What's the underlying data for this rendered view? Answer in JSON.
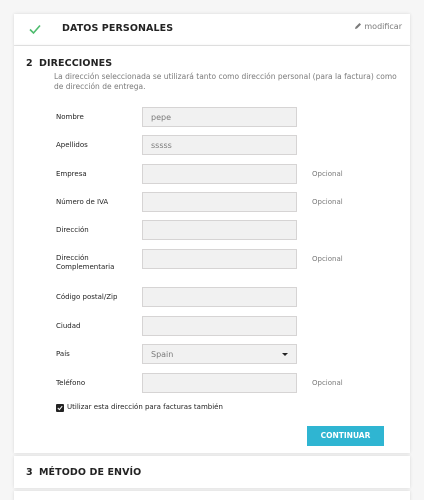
{
  "personal": {
    "title": "DATOS PERSONALES",
    "modify": "modificar"
  },
  "addresses": {
    "step": "2",
    "title": "DIRECCIONES",
    "intro": "La dirección seleccionada se utilizará tanto como dirección personal (para la factura) como de dirección de entrega.",
    "fields": {
      "nombre": {
        "label": "Nombre",
        "value": "pepe"
      },
      "apellidos": {
        "label": "Apellidos",
        "value": "sssss"
      },
      "empresa": {
        "label": "Empresa",
        "value": "",
        "optional": "Opcional"
      },
      "iva": {
        "label": "Número de IVA",
        "value": "",
        "optional": "Opcional"
      },
      "direccion": {
        "label": "Dirección",
        "value": ""
      },
      "direccion2": {
        "label": "Dirección Complementaria",
        "value": "",
        "optional": "Opcional"
      },
      "cp": {
        "label": "Código postal/Zip",
        "value": ""
      },
      "ciudad": {
        "label": "Ciudad",
        "value": ""
      },
      "pais": {
        "label": "País",
        "value": "Spain"
      },
      "telefono": {
        "label": "Teléfono",
        "value": "",
        "optional": "Opcional"
      }
    },
    "use_for_invoice": "Utilizar esta dirección para facturas también",
    "continue": "CONTINUAR"
  },
  "shipping": {
    "step": "3",
    "title": "MÉTODO DE ENVÍO"
  },
  "colors": {
    "accent": "#2fb5d2",
    "check": "#4cbb6c"
  }
}
